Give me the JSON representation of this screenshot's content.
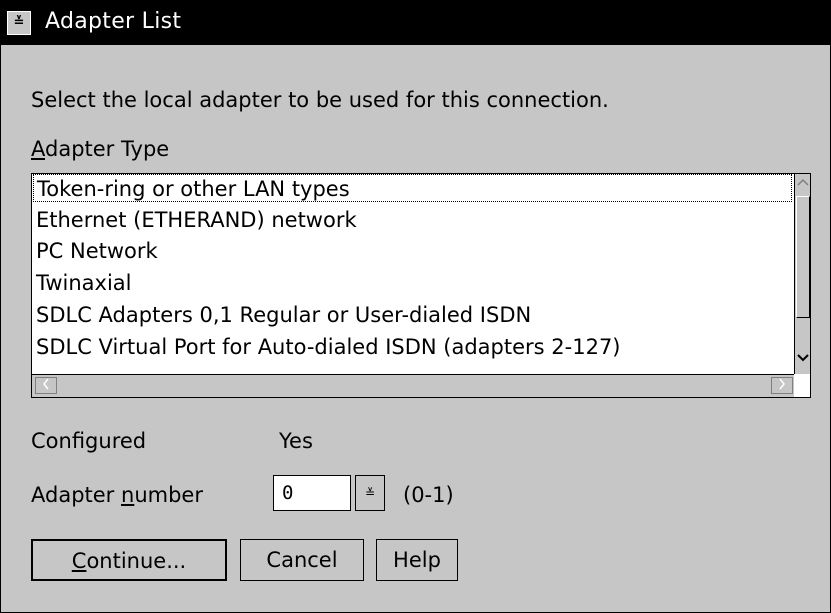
{
  "window": {
    "title": "Adapter List"
  },
  "titlebar": {
    "sysmenu_icon": "window-menu-icon",
    "sysmenu_glyph": "≚"
  },
  "instruction": "Select the local adapter to be used for this connection.",
  "adapter_type": {
    "label": "Adapter Type",
    "items": [
      "Token-ring or other LAN types",
      "Ethernet (ETHERAND) network",
      "PC Network",
      "Twinaxial",
      "SDLC Adapters 0,1 Regular or User-dialed ISDN",
      "SDLC Virtual Port for Auto-dialed ISDN (adapters 2-127)"
    ],
    "selected_index": 0
  },
  "configured": {
    "label": "Configured",
    "value": "Yes"
  },
  "adapter_number": {
    "label": "Adapter number",
    "value": "0",
    "range": "(0-1)",
    "spin_glyph": "≚"
  },
  "buttons": {
    "continue": "Continue...",
    "cancel": "Cancel",
    "help": "Help"
  }
}
